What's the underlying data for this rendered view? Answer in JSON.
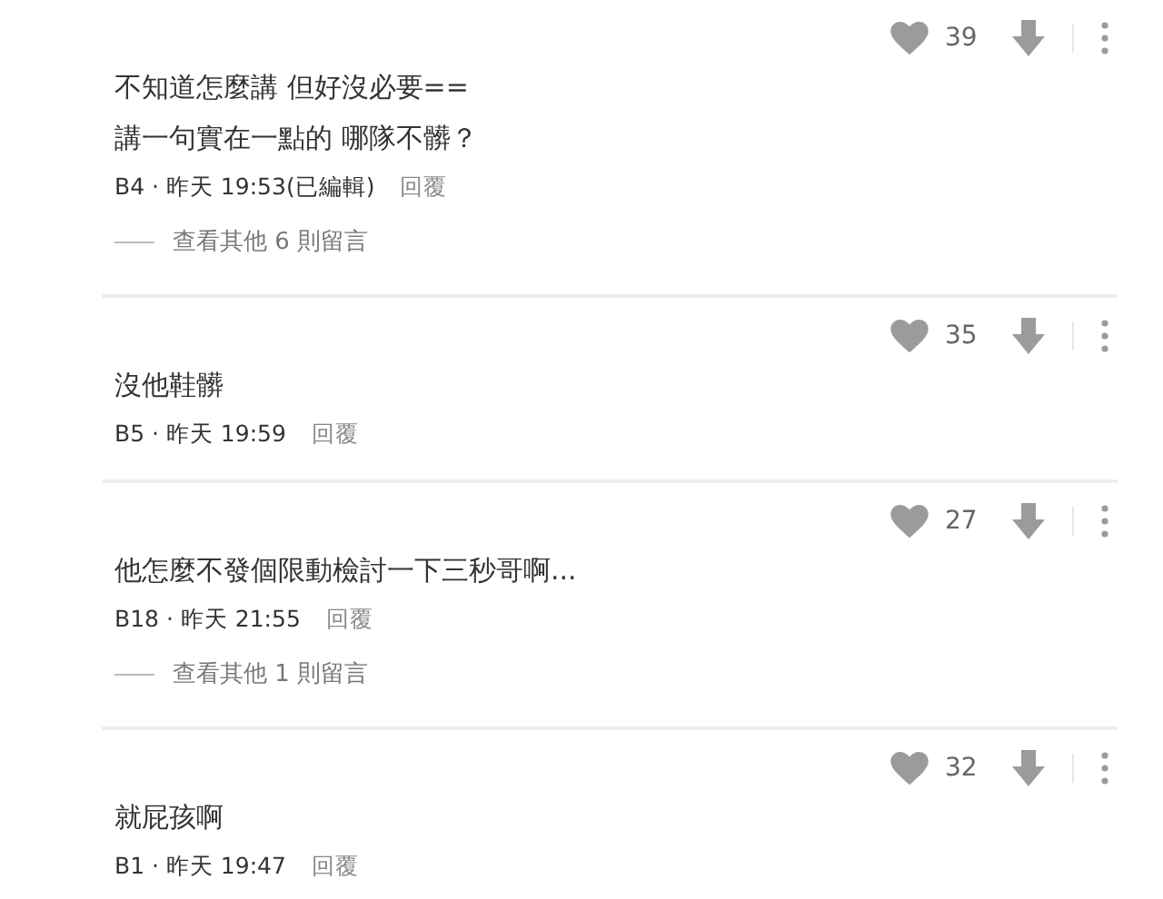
{
  "comments": [
    {
      "likes": "39",
      "lines": [
        "不知道怎麼講 但好沒必要==",
        "講一句實在一點的 哪隊不髒？"
      ],
      "floor": "B4 ·",
      "time": "昨天 19:53",
      "edited": "(已編輯)",
      "reply": "回覆",
      "more_replies": "查看其他 6 則留言"
    },
    {
      "likes": "35",
      "lines": [
        "沒他鞋髒"
      ],
      "floor": "B5 ·",
      "time": "昨天 19:59",
      "reply": "回覆"
    },
    {
      "likes": "27",
      "lines": [
        "他怎麼不發個限動檢討一下三秒哥啊..."
      ],
      "floor": "B18 ·",
      "time": "昨天 21:55",
      "reply": "回覆",
      "more_replies": "查看其他 1 則留言"
    },
    {
      "likes": "32",
      "lines": [
        "就屁孩啊"
      ],
      "floor": "B1 ·",
      "time": "昨天 19:47",
      "reply": "回覆"
    }
  ]
}
